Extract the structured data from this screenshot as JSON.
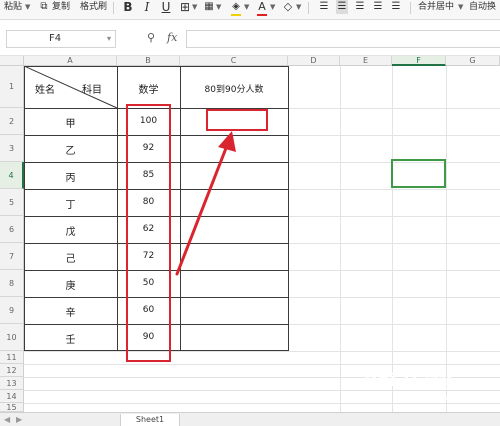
{
  "toolbar": {
    "paste_label": "粘贴",
    "copy_label": "复制",
    "format_painter_label": "格式刷",
    "merge_center_label": "合并居中",
    "auto_wrap_label": "自动换"
  },
  "formula_bar": {
    "name_box_value": "F4",
    "fx_label": "fx",
    "formula_value": ""
  },
  "columns": [
    "A",
    "B",
    "C",
    "D",
    "E",
    "F",
    "G"
  ],
  "rows": [
    "1",
    "2",
    "3",
    "4",
    "5",
    "6",
    "7",
    "8",
    "9",
    "10",
    "11",
    "12",
    "13",
    "14",
    "15"
  ],
  "table": {
    "header_name": "姓名",
    "header_subject": "科目",
    "header_math": "数学",
    "header_count": "80到90分人数",
    "names": [
      "甲",
      "乙",
      "丙",
      "丁",
      "戊",
      "己",
      "庚",
      "辛",
      "壬"
    ],
    "math_scores": [
      "100",
      "92",
      "85",
      "80",
      "62",
      "72",
      "50",
      "60",
      "90"
    ]
  },
  "selection": {
    "active_cell": "F4",
    "active_column": "F",
    "active_row": "4"
  },
  "sheet_tabs": [
    "Sheet1"
  ],
  "watermark": {
    "brand": "Bai",
    "brand2": "经验",
    "domain": "jingyan.baidu.com"
  },
  "colors": {
    "annotation_red": "#d9252f",
    "selection_green": "#3f9a48",
    "border": "#3a3a3a"
  }
}
